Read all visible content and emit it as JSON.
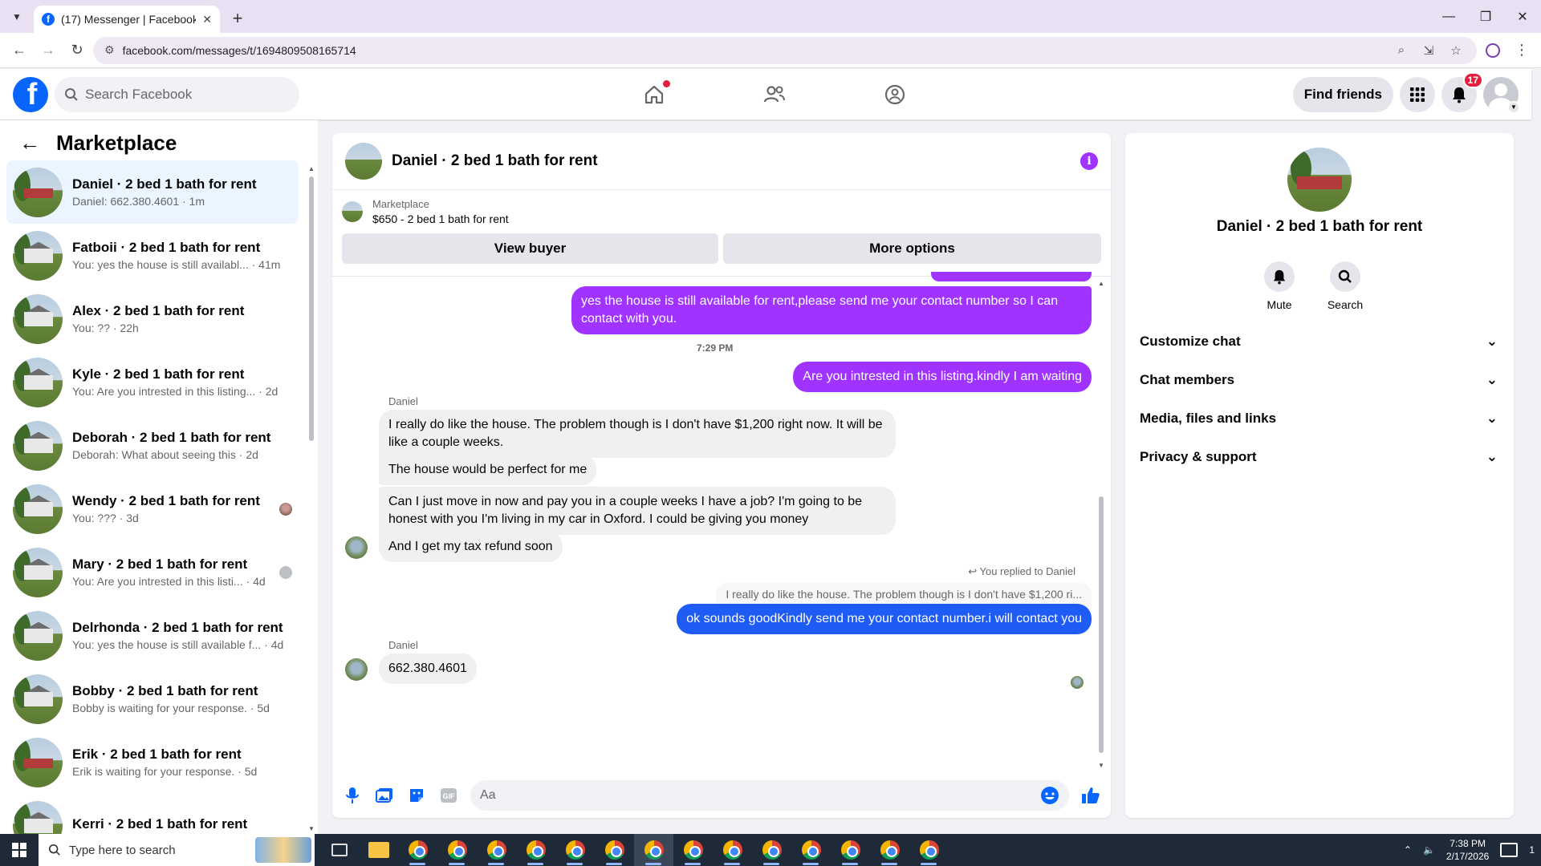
{
  "browser": {
    "tab_title": "(17) Messenger | Facebook",
    "url": "facebook.com/messages/t/1694809508165714"
  },
  "header": {
    "search_placeholder": "Search Facebook",
    "find_friends": "Find friends",
    "notification_count": "17"
  },
  "left_panel": {
    "title": "Marketplace",
    "conversations": [
      {
        "name": "Daniel · 2 bed 1 bath for rent",
        "snippet": "Daniel: 662.380.4601 · 1m"
      },
      {
        "name": "Fatboii · 2 bed 1 bath for rent",
        "snippet": "You: yes the house is still availabl...  · 41m"
      },
      {
        "name": "Alex · 2 bed 1 bath for rent",
        "snippet": "You: ?? · 22h"
      },
      {
        "name": "Kyle · 2 bed 1 bath for rent",
        "snippet": "You: Are you intrested in this listing... · 2d"
      },
      {
        "name": "Deborah · 2 bed 1 bath for rent",
        "snippet": "Deborah: What about seeing this · 2d"
      },
      {
        "name": "Wendy · 2 bed 1 bath for rent",
        "snippet": "You: ??? · 3d"
      },
      {
        "name": "Mary · 2 bed 1 bath for rent",
        "snippet": "You: Are you intrested in this listi... · 4d"
      },
      {
        "name": "Delrhonda · 2 bed 1 bath for rent",
        "snippet": "You: yes the house is still available f... · 4d"
      },
      {
        "name": "Bobby · 2 bed 1 bath for rent",
        "snippet": "Bobby is waiting for your response. · 5d"
      },
      {
        "name": "Erik · 2 bed 1 bath for rent",
        "snippet": "Erik is waiting for your response. · 5d"
      },
      {
        "name": "Kerri · 2 bed 1 bath for rent",
        "snippet": ""
      }
    ]
  },
  "chat": {
    "title": "Daniel · 2 bed 1 bath for rent",
    "marketplace_label": "Marketplace",
    "listing": "$650 - 2 bed 1 bath for rent",
    "view_buyer": "View buyer",
    "more_options": "More options",
    "messages": {
      "m1": "yes the house is still available for rent,please send me your contact number so I can contact with you.",
      "time1": "7:29 PM",
      "m2": "Are you intrested in this listing.kindly I am waiting",
      "sender1": "Daniel",
      "m3": "I really do like the house. The problem though is I don't have $1,200 right now. It will be like a couple weeks.",
      "m4": "The house would be perfect for me",
      "m5": "Can I just move in now and pay you in a couple weeks I have a job? I'm going to be honest with you I'm living in my car in Oxford. I could be giving you money",
      "m6": "And I get my tax refund soon",
      "reply_meta": "You replied to Daniel",
      "quoted": "I really do like the house. The problem though is I don't have $1,200 ri...",
      "m7": "ok sounds goodKindly send me your contact number.i will contact you",
      "sender2": "Daniel",
      "m8": "662.380.4601"
    },
    "composer_placeholder": "Aa"
  },
  "right_panel": {
    "name": "Daniel · 2 bed 1 bath for rent",
    "mute": "Mute",
    "search": "Search",
    "sections": [
      "Customize chat",
      "Chat members",
      "Media, files and links",
      "Privacy & support"
    ]
  },
  "taskbar": {
    "search_placeholder": "Type here to search",
    "time": "7:38 PM",
    "date": "2/17/2026",
    "notif": "1"
  },
  "colors": {
    "brand": "#0866ff",
    "outgoing": "#a033ff",
    "outgoing_blue": "#1e5cf5",
    "badge": "#e41e3f"
  }
}
